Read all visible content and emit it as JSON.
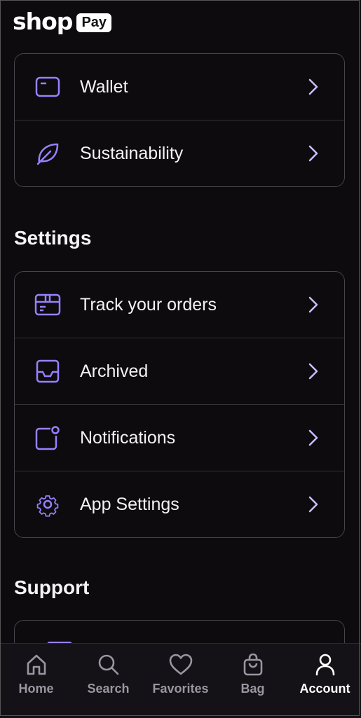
{
  "brand": {
    "word": "shop",
    "badge": "Pay"
  },
  "colors": {
    "accent": "#9a80ff",
    "background": "#0d0b0e"
  },
  "top_card": {
    "items": [
      {
        "label": "Wallet",
        "icon": "wallet-icon"
      },
      {
        "label": "Sustainability",
        "icon": "leaf-icon"
      }
    ]
  },
  "settings": {
    "title": "Settings",
    "items": [
      {
        "label": "Track your orders",
        "icon": "package-icon"
      },
      {
        "label": "Archived",
        "icon": "archive-icon"
      },
      {
        "label": "Notifications",
        "icon": "notification-icon"
      },
      {
        "label": "App Settings",
        "icon": "gear-icon"
      }
    ]
  },
  "support": {
    "title": "Support"
  },
  "tabbar": {
    "items": [
      {
        "label": "Home",
        "icon": "home-icon",
        "active": false
      },
      {
        "label": "Search",
        "icon": "search-icon",
        "active": false
      },
      {
        "label": "Favorites",
        "icon": "heart-icon",
        "active": false
      },
      {
        "label": "Bag",
        "icon": "bag-icon",
        "active": false
      },
      {
        "label": "Account",
        "icon": "person-icon",
        "active": true
      }
    ]
  }
}
